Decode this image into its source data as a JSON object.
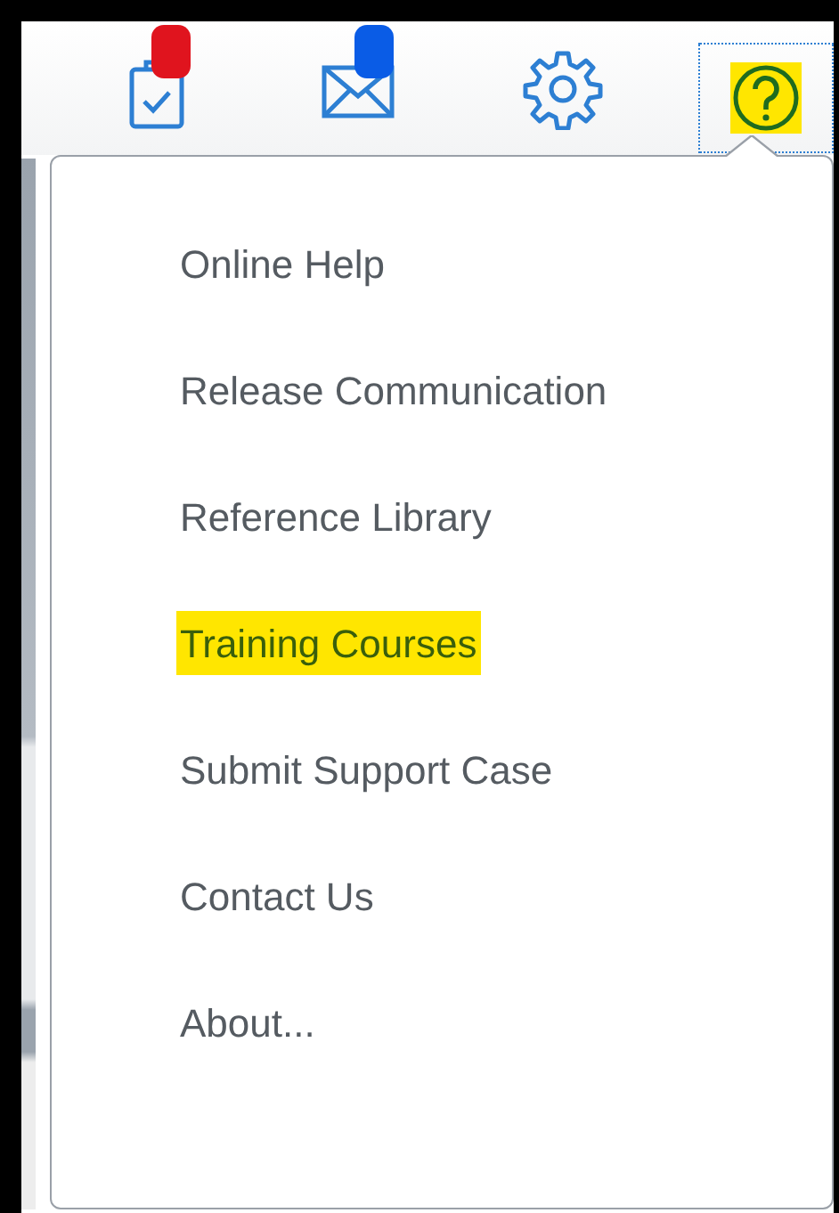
{
  "toolbar": [
    {
      "kind": "tasks",
      "selected": false,
      "badge": {
        "color": "#e0141e"
      }
    },
    {
      "kind": "mail",
      "selected": false,
      "badge": {
        "color": "#0a5ce6"
      }
    },
    {
      "kind": "settings",
      "selected": false
    },
    {
      "kind": "help",
      "selected": true
    }
  ],
  "help_menu": {
    "items": [
      {
        "label": "Online Help",
        "selected": false
      },
      {
        "label": "Release Communication",
        "selected": false
      },
      {
        "label": "Reference Library",
        "selected": false
      },
      {
        "label": "Training Courses",
        "selected": true
      },
      {
        "label": "Submit Support Case",
        "selected": false
      },
      {
        "label": "Contact Us",
        "selected": false
      },
      {
        "label": "About...",
        "selected": false
      }
    ]
  }
}
